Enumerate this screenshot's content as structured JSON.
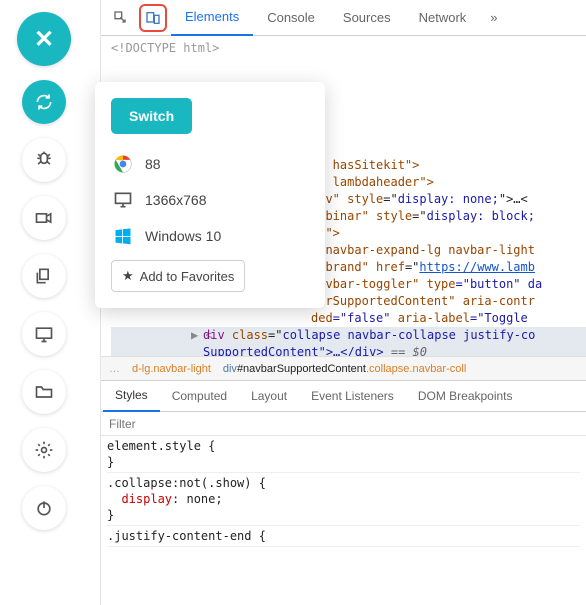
{
  "sidebar": {
    "close": "✕",
    "items": [
      "sync",
      "bug",
      "video",
      "copy",
      "screen",
      "folder",
      "gear",
      "power"
    ]
  },
  "devtools": {
    "tabs": [
      "Elements",
      "Console",
      "Sources",
      "Network"
    ],
    "active_tab": 0,
    "more": "»",
    "doctype": "<!DOCTYPE html>",
    "dom_fragments": {
      "l1a": "er hasSitekit\">",
      "l2a": "te lambdaheader\">",
      "l3a": "div\" ",
      "l3b": "style",
      "l3c": "=\"",
      "l3d": "display: none;",
      "l3e": "\">…<",
      "l4a": "webinar\" ",
      "l4b": "style",
      "l4c": "=\"",
      "l4d": "display: block;",
      "l4e": "",
      "l5a": "er\">",
      "l6a": "r navbar-expand-lg navbar-light",
      "l7a": "r-brand\" ",
      "l7b": "href",
      "l7c": "=\"",
      "l7d": "https://www.lamb",
      "l8a": "navbar-toggler\" ",
      "l8b": "type",
      "l8c": "=\"button\" da",
      "l9a": "barSupportedContent\" ",
      "l9b": "aria-contr",
      "l10a": "ded",
      "l10b": "=\"false\" ",
      "l10c": "aria-label",
      "l10d": "=\"Toggle ",
      "sel_prefix": "▶ <",
      "sel_tag": "div",
      "sel_a": " class",
      "sel_b": "=\"",
      "sel_c": "collapse navbar-collapse justify-co",
      "sel_d": "",
      "sel2a": "SupportedContent\">…</div>",
      "sel2b": " == $0"
    },
    "breadcrumb": {
      "ell": "…",
      "item1": "d-lg.navbar-light",
      "item2_pre": "div",
      "item2_mid": "#navbarSupportedContent",
      "item2_suf": ".collapse.navbar-coll"
    },
    "styles_tabs": [
      "Styles",
      "Computed",
      "Layout",
      "Event Listeners",
      "DOM Breakpoints"
    ],
    "styles_active": 0,
    "filter_placeholder": "Filter",
    "css": {
      "r1_sel": "element.style",
      "r2_sel": ".collapse:not(.show)",
      "r2_prop": "display",
      "r2_val": "none",
      "r3_sel": ".justify-content-end"
    }
  },
  "popover": {
    "switch_label": "Switch",
    "browser_version": "88",
    "resolution": "1366x768",
    "os": "Windows 10",
    "favorites_label": "Add to Favorites"
  }
}
